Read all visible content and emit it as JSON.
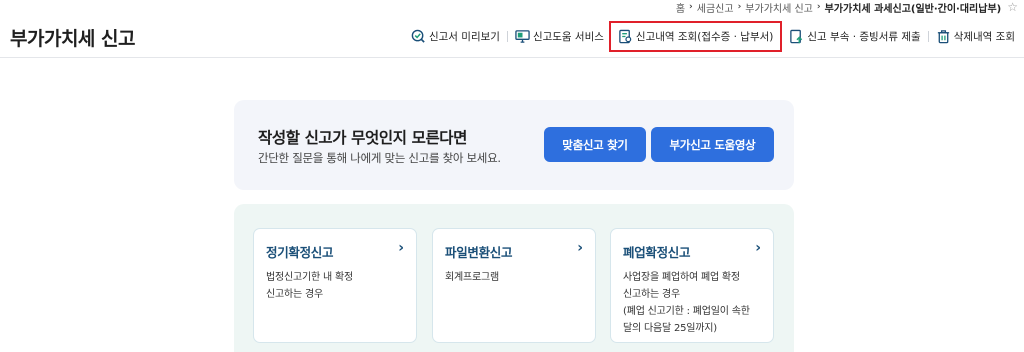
{
  "breadcrumb": {
    "items": [
      "홈",
      "세금신고",
      "부가가치세 신고",
      "부가가치세 과세신고(일반·간이·대리납부)"
    ],
    "favorite_icon": "star-icon"
  },
  "header": {
    "title": "부가가치세 신고",
    "menu": [
      {
        "label": "신고서 미리보기",
        "icon": "preview-check-icon"
      },
      {
        "label": "신고도움 서비스",
        "icon": "monitor-help-icon"
      },
      {
        "label": "신고내역 조회(접수증 · 납부서)",
        "icon": "document-search-icon",
        "highlighted": true
      },
      {
        "label": "신고 부속 · 증빙서류 제출",
        "icon": "upload-document-icon"
      },
      {
        "label": "삭제내역 조회",
        "icon": "trash-icon"
      }
    ]
  },
  "banner": {
    "title": "작성할 신고가 무엇인지 모른다면",
    "desc": "간단한 질문을 통해 나에게 맞는 신고를 찾아 보세요.",
    "btn_find": "맞춤신고 찾기",
    "btn_video": "부가신고 도움영상"
  },
  "cards": [
    {
      "title": "정기확정신고",
      "arrow": "›",
      "lines": [
        "법정신고기한 내 확정",
        "신고하는 경우"
      ]
    },
    {
      "title": "파일변환신고",
      "arrow": "›",
      "lines": [
        "회계프로그램"
      ]
    },
    {
      "title": "폐업확정신고",
      "arrow": "›",
      "lines": [
        "사업장을 폐업하여 폐업 확정",
        "신고하는 경우",
        "(폐업 신고기한 : 폐업일이 속한",
        "달의 다음달 25일까지)"
      ]
    }
  ],
  "colors": {
    "accent_button": "#2e6fde",
    "card_title": "#1a4f78",
    "highlight_box": "#e0202a",
    "banner_bg": "#f3f5fa",
    "cards_bg": "#eef6f4"
  }
}
